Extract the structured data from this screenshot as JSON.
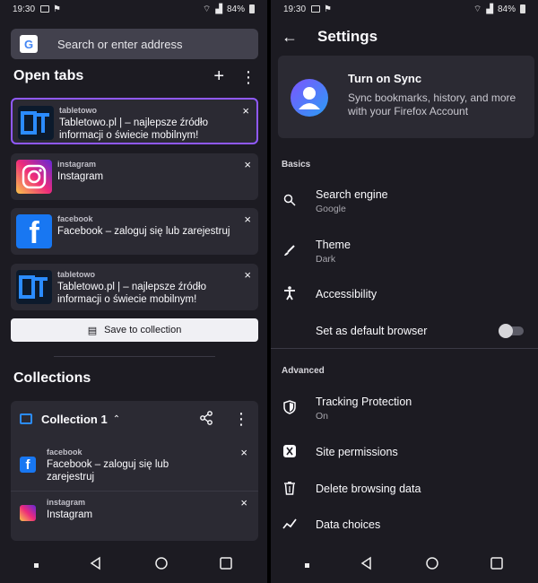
{
  "left": {
    "status": {
      "time": "19:30",
      "battery": "84%"
    },
    "search": {
      "placeholder": "Search or enter address"
    },
    "open_tabs": {
      "title": "Open tabs",
      "tabs": [
        {
          "site": "tabletowo",
          "title": "Tabletowo.pl | – najlepsze źródło informacji o świecie mobilnym!",
          "close": "×"
        },
        {
          "site": "instagram",
          "title": "Instagram",
          "close": "×"
        },
        {
          "site": "facebook",
          "title": "Facebook – zaloguj się lub zarejestruj",
          "close": "×"
        },
        {
          "site": "tabletowo",
          "title": "Tabletowo.pl | – najlepsze źródło informacji o świecie mobilnym!",
          "close": "×"
        }
      ],
      "save_label": "Save to collection"
    },
    "collections": {
      "title": "Collections",
      "collection_name": "Collection 1",
      "items": [
        {
          "site": "facebook",
          "title": "Facebook – zaloguj się lub zarejestruj",
          "close": "×"
        },
        {
          "site": "instagram",
          "title": "Instagram",
          "close": "×"
        }
      ]
    }
  },
  "right": {
    "status": {
      "time": "19:30",
      "battery": "84%"
    },
    "title": "Settings",
    "sync": {
      "heading": "Turn on Sync",
      "description": "Sync bookmarks, history, and more with your Firefox Account"
    },
    "basics": {
      "label": "Basics",
      "search_engine": {
        "label": "Search engine",
        "value": "Google"
      },
      "theme": {
        "label": "Theme",
        "value": "Dark"
      },
      "accessibility": "Accessibility",
      "default_browser": "Set as default browser"
    },
    "advanced": {
      "label": "Advanced",
      "tracking": {
        "label": "Tracking Protection",
        "value": "On"
      },
      "site_permissions": "Site permissions",
      "delete_data": "Delete browsing data",
      "data_choices": "Data choices"
    }
  },
  "colors": {
    "accent": "#9059ff",
    "panel": "#1c1b22",
    "card": "#2b2a33"
  }
}
